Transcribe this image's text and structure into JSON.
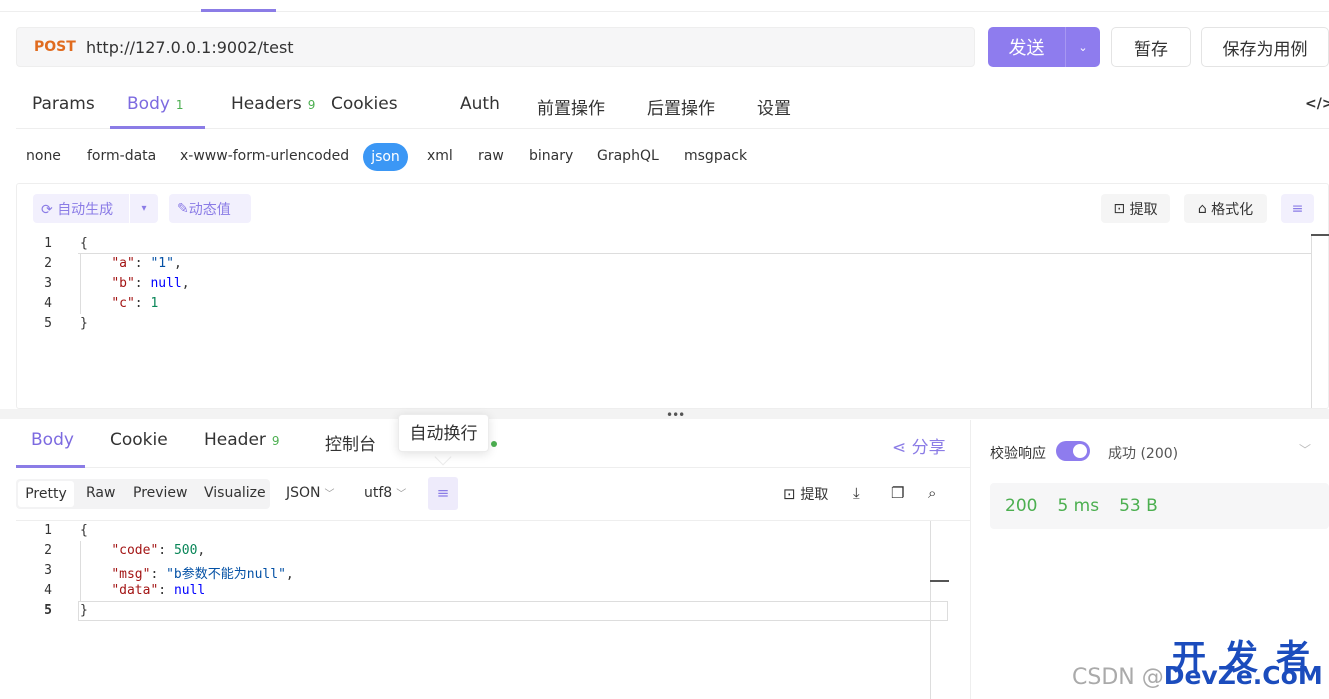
{
  "request": {
    "method": "POST",
    "url": "http://127.0.0.1:9002/test",
    "send_label": "发送",
    "draft_label": "暂存",
    "save_case_label": "保存为用例",
    "tabs": [
      {
        "label": "Params",
        "count": ""
      },
      {
        "label": "Body",
        "count": "1"
      },
      {
        "label": "Headers",
        "count": "9"
      },
      {
        "label": "Cookies",
        "count": ""
      },
      {
        "label": "Auth",
        "count": ""
      },
      {
        "label": "前置操作",
        "count": ""
      },
      {
        "label": "后置操作",
        "count": ""
      },
      {
        "label": "设置",
        "count": ""
      }
    ],
    "active_tab": "Body",
    "body_types": [
      "none",
      "form-data",
      "x-www-form-urlencoded",
      "json",
      "xml",
      "raw",
      "binary",
      "GraphQL",
      "msgpack"
    ],
    "active_body_type": "json",
    "auto_generate_label": "自动生成",
    "dynamic_value_label": "动态值",
    "extract_label": "提取",
    "format_label": "格式化",
    "code_lines": [
      "1",
      "2",
      "3",
      "4",
      "5"
    ],
    "code": {
      "l1": "{",
      "a_key": "\"a\"",
      "a_val": "\"1\"",
      "b_key": "\"b\"",
      "b_val": "null",
      "c_key": "\"c\"",
      "c_val": "1",
      "l5": "}"
    }
  },
  "response": {
    "tabs": [
      {
        "label": "Body",
        "count": ""
      },
      {
        "label": "Cookie",
        "count": ""
      },
      {
        "label": "Header",
        "count": "9"
      },
      {
        "label": "控制台",
        "count": ""
      }
    ],
    "active_tab": "Body",
    "share_label": "分享",
    "tooltip": "自动换行",
    "view_modes": [
      "Pretty",
      "Raw",
      "Preview",
      "Visualize"
    ],
    "active_view": "Pretty",
    "format_select": "JSON",
    "encoding_select": "utf8",
    "extract_label": "提取",
    "code_lines": [
      "1",
      "2",
      "3",
      "4",
      "5"
    ],
    "code": {
      "l1": "{",
      "code_key": "\"code\"",
      "code_val": "500",
      "msg_key": "\"msg\"",
      "msg_val": "\"b参数不能为null\"",
      "data_key": "\"data\"",
      "data_val": "null",
      "l5": "}"
    },
    "validate_label": "校验响应",
    "validate_enabled": true,
    "success_label": "成功 (200)",
    "status_code": "200",
    "time": "5 ms",
    "size": "53 B"
  },
  "watermark": {
    "top": "开发者",
    "bottom_prefix": "CSDN @",
    "bottom_brand": "DevZe.CoM"
  },
  "colors": {
    "accent": "#8e7cee",
    "method": "#e06b1f",
    "json_pill": "#3b97f5",
    "success": "#4caf50"
  }
}
